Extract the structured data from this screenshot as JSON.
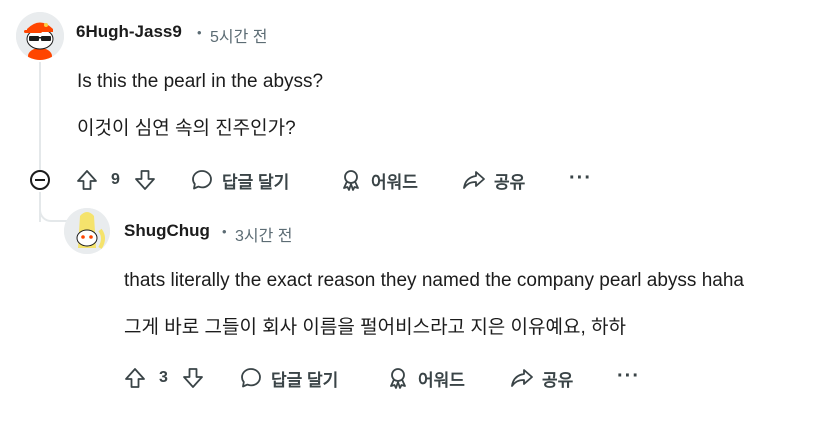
{
  "comments": [
    {
      "username": "6Hugh-Jass9",
      "time": "5시간 전",
      "lines": [
        "Is this the pearl in the abyss?",
        "이것이 심연 속의 진주인가?"
      ],
      "votes": "9",
      "reply_label": "답글 달기",
      "award_label": "어워드",
      "share_label": "공유",
      "more_label": "···"
    },
    {
      "username": "ShugChug",
      "time": "3시간 전",
      "lines": [
        "thats literally the exact reason they named the company pearl abyss haha",
        "그게 바로 그들이 회사 이름을 펄어비스라고 지은 이유예요, 하하"
      ],
      "votes": "3",
      "reply_label": "답글 달기",
      "award_label": "어워드",
      "share_label": "공유",
      "more_label": "···"
    }
  ],
  "separator": "•",
  "colors": {
    "text": "#1c1c1c",
    "meta": "#5c6c74",
    "action": "#3a4447",
    "thread_line": "#e4e8ea"
  }
}
